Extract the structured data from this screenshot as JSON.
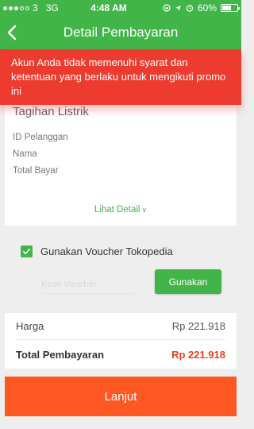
{
  "status_bar": {
    "carrier": "3",
    "network": "3G",
    "time": "4:48 AM",
    "battery": "60%",
    "icons": [
      "lock-rotation-icon",
      "location-arrow-icon",
      "alarm-icon",
      "battery-icon"
    ]
  },
  "header": {
    "title": "Detail Pembayaran",
    "back_icon": "chevron-left-icon"
  },
  "alert": {
    "message": "Akun Anda tidak memenuhi syarat dan ketentuan yang berlaku untuk mengikuti promo ini",
    "color": "#ee3b30"
  },
  "bill": {
    "title": "Tagihan Listrik",
    "fields": [
      "ID Pelanggan",
      "Nama",
      "Total Bayar"
    ],
    "detail_link": "Lihat Detail"
  },
  "voucher": {
    "checked": true,
    "label": "Gunakan Voucher Tokopedia",
    "code_placeholder": "Kode Voucher",
    "apply_label": "Gunakan"
  },
  "summary": {
    "price_label": "Harga",
    "price_value": "Rp 221.918",
    "total_label": "Total Pembayaran",
    "total_value": "Rp 221.918"
  },
  "footer": {
    "continue_label": "Lanjut"
  },
  "colors": {
    "brand_green": "#42b549",
    "cta_orange": "#ff5722",
    "total_red": "#e8401c"
  }
}
